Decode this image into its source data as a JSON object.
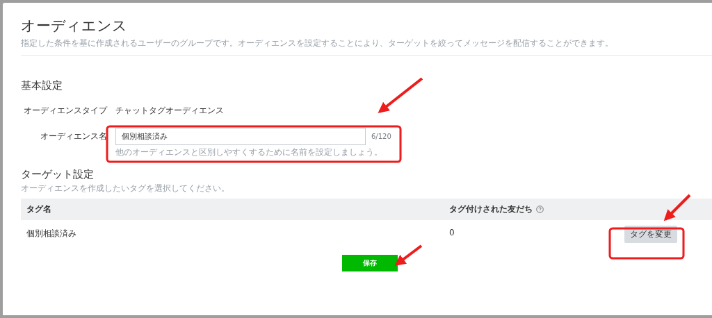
{
  "page": {
    "title": "オーディエンス",
    "description": "指定した条件を基に作成されるユーザーのグループです。オーディエンスを設定することにより、ターゲットを絞ってメッセージを配信することができます。"
  },
  "basic_settings": {
    "heading": "基本設定",
    "fields": [
      {
        "kind": "text",
        "label": "オーディエンスタイプ",
        "value": "チャットタグオーディエンス"
      },
      {
        "kind": "input",
        "label": "オーディエンス名",
        "value": "個別相談済み",
        "counter": "6/120",
        "hint": "他のオーディエンスと区別しやすくするために名前を設定しましょう。"
      }
    ]
  },
  "target_settings": {
    "heading": "ターゲット設定",
    "description": "オーディエンスを作成したいタグを選択してください。",
    "table": {
      "columns": [
        {
          "label": "タグ名",
          "help": false
        },
        {
          "label": "タグ付けされた友だち",
          "help": true
        }
      ],
      "rows": [
        {
          "tag": "個別相談済み",
          "friends": "0",
          "action": "タグを変更"
        }
      ]
    }
  },
  "save_button": "保存"
}
